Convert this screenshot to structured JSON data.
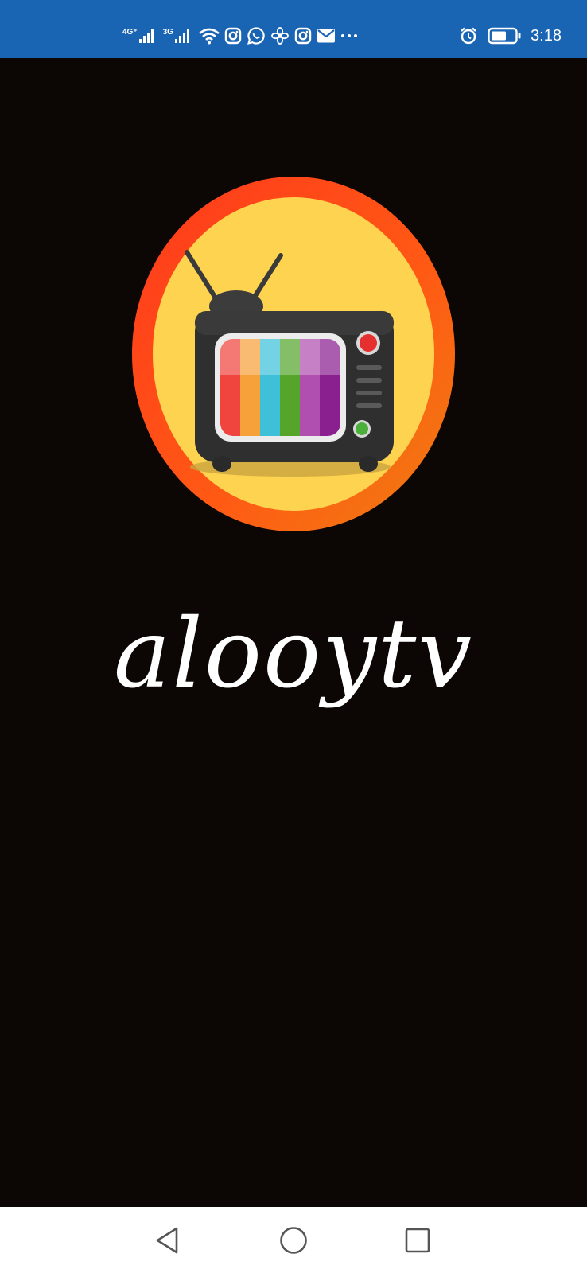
{
  "status_bar": {
    "network_1": "4G⁺",
    "network_2": "3G",
    "time": "3:18",
    "icons": [
      "signal-icon",
      "signal-icon",
      "wifi-icon",
      "instagram-icon",
      "whatsapp-icon",
      "flower-icon",
      "instagram-icon",
      "mail-icon",
      "more-icon",
      "alarm-icon",
      "battery-icon"
    ]
  },
  "splash": {
    "app_name": "alooytv",
    "logo": "tv-logo",
    "colors": {
      "background": "#0c0604",
      "logo_ring": "#ff3b1e",
      "logo_fill": "#fdd34f",
      "tv_body": "#2f2f2f"
    }
  },
  "nav_bar": {
    "buttons": [
      "back-icon",
      "home-icon",
      "recents-icon"
    ]
  },
  "colors": {
    "status_bar": "#1a64b4",
    "nav_bar": "#ffffff"
  }
}
